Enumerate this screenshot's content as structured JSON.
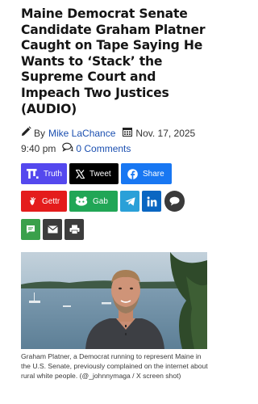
{
  "article": {
    "headline": "Maine Democrat Senate Candidate Graham Platner Caught on Tape Saying He Wants to ‘Stack’ the Supreme Court and Impeach Two Justices (AUDIO)",
    "by_prefix": "By",
    "author": "Mike LaChance",
    "date": "Nov. 17, 2025",
    "time": "9:40 pm",
    "comments": "0 Comments"
  },
  "share_buttons": [
    {
      "name": "truth",
      "label": "Truth",
      "color": "#5448ee",
      "icon": "truth-social-icon"
    },
    {
      "name": "tweet",
      "label": "Tweet",
      "color": "#000000",
      "icon": "x-icon"
    },
    {
      "name": "share",
      "label": "Share",
      "color": "#1877f2",
      "icon": "facebook-icon"
    },
    {
      "name": "gettr",
      "label": "Gettr",
      "color": "#e41c1c",
      "icon": "gettr-icon"
    },
    {
      "name": "gab",
      "label": "Gab",
      "color": "#21a656",
      "icon": "gab-icon"
    },
    {
      "name": "telegram",
      "label": "",
      "color": "#2aa0d8",
      "icon": "telegram-icon"
    },
    {
      "name": "linkedin",
      "label": "",
      "color": "#0a66c2",
      "icon": "linkedin-icon"
    },
    {
      "name": "comment",
      "label": "",
      "color": "#3a3a3a",
      "icon": "speech-bubble-icon"
    },
    {
      "name": "sms",
      "label": "",
      "color": "#3aa04b",
      "icon": "sms-icon"
    },
    {
      "name": "email",
      "label": "",
      "color": "#3c3c3c",
      "icon": "envelope-icon"
    },
    {
      "name": "print",
      "label": "",
      "color": "#3c3c3c",
      "icon": "printer-icon"
    }
  ],
  "photo": {
    "caption": "Graham Platner, a Democrat running to represent Maine in the U.S. Senate, previously complained on the internet about rural white people. (@_johnnymaga / X screen shot)"
  }
}
